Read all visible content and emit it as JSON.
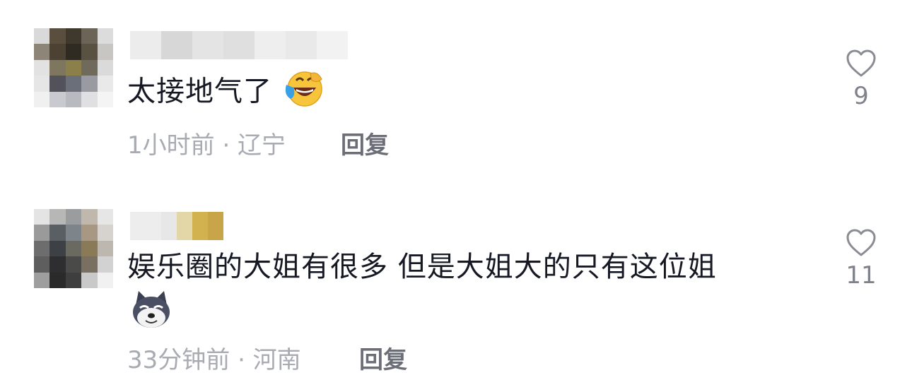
{
  "comments": [
    {
      "text": "太接地气了",
      "emoji": "laughing-crying-face-icon",
      "time_location": "1小时前 · 辽宁",
      "reply_label": "回复",
      "likes": "9"
    },
    {
      "text": "娱乐圈的大姐有很多 但是大姐大的只有这位姐",
      "emoji": "husky-dog-face-icon",
      "time_location": "33分钟前 · 河南",
      "reply_label": "回复",
      "likes": "11"
    }
  ],
  "colors": {
    "text": "#161823",
    "meta": "#a9abb3",
    "reply": "#6b6e77",
    "like_icon": "#8a8c94"
  }
}
